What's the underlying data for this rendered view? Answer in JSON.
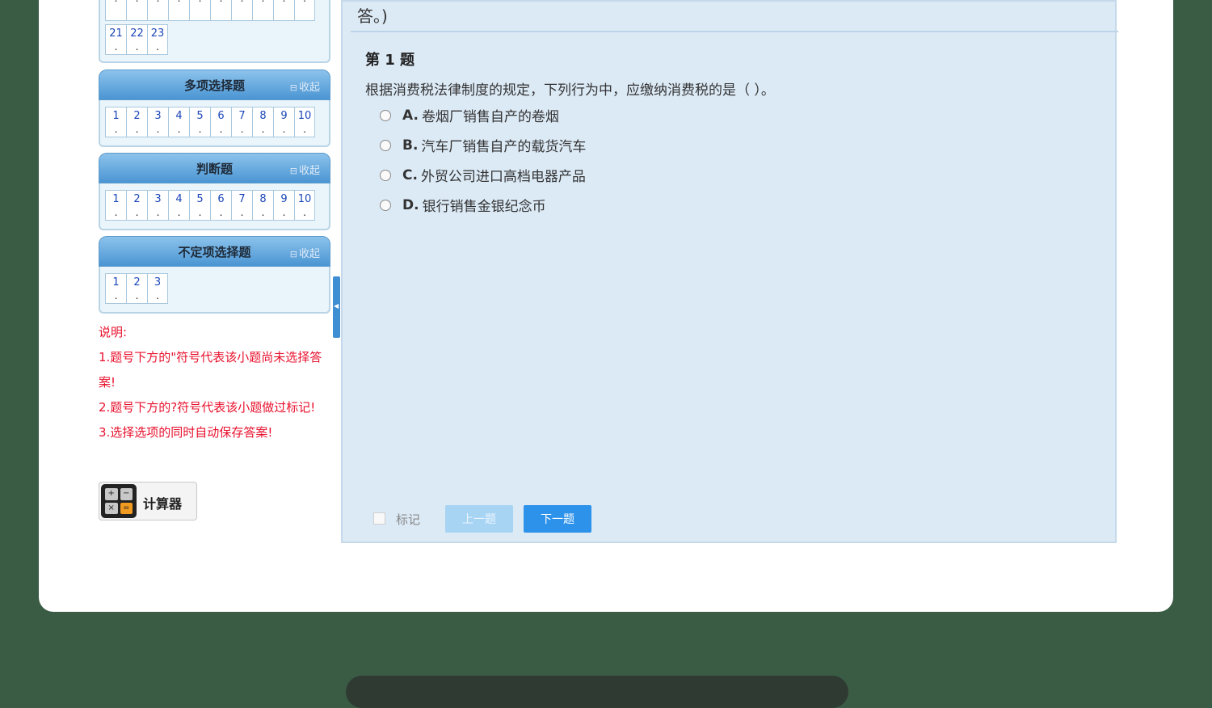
{
  "left_panel": {
    "top_grid": {
      "partial_row": [
        "",
        "",
        "",
        "",
        "",
        "",
        "",
        "",
        "",
        ""
      ],
      "numbers": [
        "21",
        "22",
        "23"
      ],
      "dot": "."
    },
    "sections": [
      {
        "title": "多项选择题",
        "collapse_label": "收起",
        "numbers": [
          "1",
          "2",
          "3",
          "4",
          "5",
          "6",
          "7",
          "8",
          "9",
          "10"
        ]
      },
      {
        "title": "判断题",
        "collapse_label": "收起",
        "numbers": [
          "1",
          "2",
          "3",
          "4",
          "5",
          "6",
          "7",
          "8",
          "9",
          "10"
        ]
      },
      {
        "title": "不定项选择题",
        "collapse_label": "收起",
        "numbers": [
          "1",
          "2",
          "3"
        ]
      }
    ],
    "notes": [
      "说明:",
      "1.题号下方的\"符号代表该小题尚未选择答案!",
      "2.题号下方的?符号代表该小题做过标记!",
      "3.选择选项的同时自动保存答案!"
    ],
    "calculator_label": "计算器"
  },
  "main": {
    "header_text": "答。)",
    "question_number": "第 1 题",
    "question_text": "根据消费税法律制度的规定，下列行为中，应缴纳消费税的是（  ）。",
    "options": [
      {
        "letter": "A.",
        "text": "卷烟厂销售自产的卷烟"
      },
      {
        "letter": "B.",
        "text": "汽车厂销售自产的载货汽车"
      },
      {
        "letter": "C.",
        "text": "外贸公司进口高档电器产品"
      },
      {
        "letter": "D.",
        "text": "银行销售金银纪念币"
      }
    ],
    "mark_label": "标记",
    "prev_label": "上一题",
    "next_label": "下一题"
  }
}
